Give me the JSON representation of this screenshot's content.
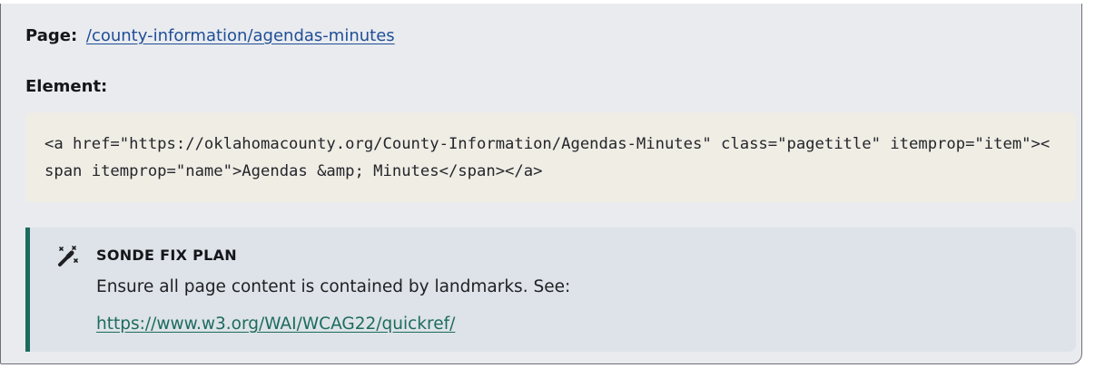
{
  "page_row": {
    "label": "Page:",
    "path": "/county-information/agendas-minutes"
  },
  "element_row": {
    "label": "Element:"
  },
  "code": {
    "snippet": "<a href=\"https://oklahomacounty.org/County-Information/Agendas-Minutes\" class=\"pagetitle\" itemprop=\"item\"><span itemprop=\"name\">Agendas &amp; Minutes</span></a>"
  },
  "fix_plan": {
    "icon": "magic-wand-icon",
    "title": "SONDE FIX PLAN",
    "text": "Ensure all page content is contained by landmarks. See:",
    "link": "https://www.w3.org/WAI/WCAG22/quickref/"
  },
  "colors": {
    "card_bg": "#e9ebef",
    "code_bg": "#efede4",
    "fix_bg": "#dde3e8",
    "accent": "#1d6b5f",
    "page_link": "#1f4e96"
  }
}
